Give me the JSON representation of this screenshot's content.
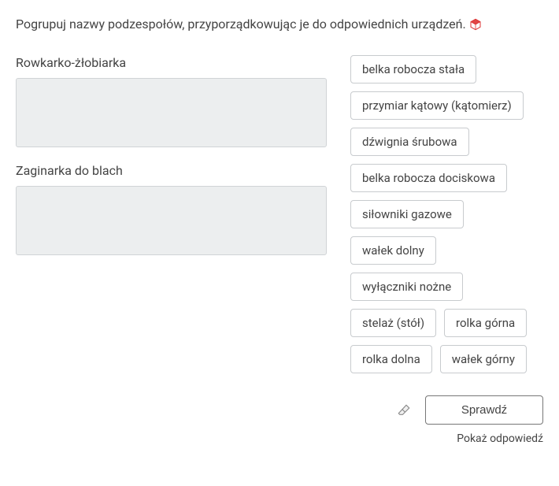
{
  "instruction": "Pogrupuj nazwy podzespołów, przyporządkowując je do odpowiednich urządzeń.",
  "dropzones": [
    {
      "label": "Rowkarko-żłobiarka"
    },
    {
      "label": "Zaginarka do blach"
    }
  ],
  "tags": [
    "belka robocza stała",
    "przymiar kątowy (kątomierz)",
    "dźwignia śrubowa",
    "belka robocza dociskowa",
    "siłowniki gazowe",
    "wałek dolny",
    "wyłączniki nożne",
    "stelaż (stół)",
    "rolka górna",
    "rolka dolna",
    "wałek górny"
  ],
  "buttons": {
    "check": "Sprawdź",
    "show_answer": "Pokaż odpowiedź"
  }
}
